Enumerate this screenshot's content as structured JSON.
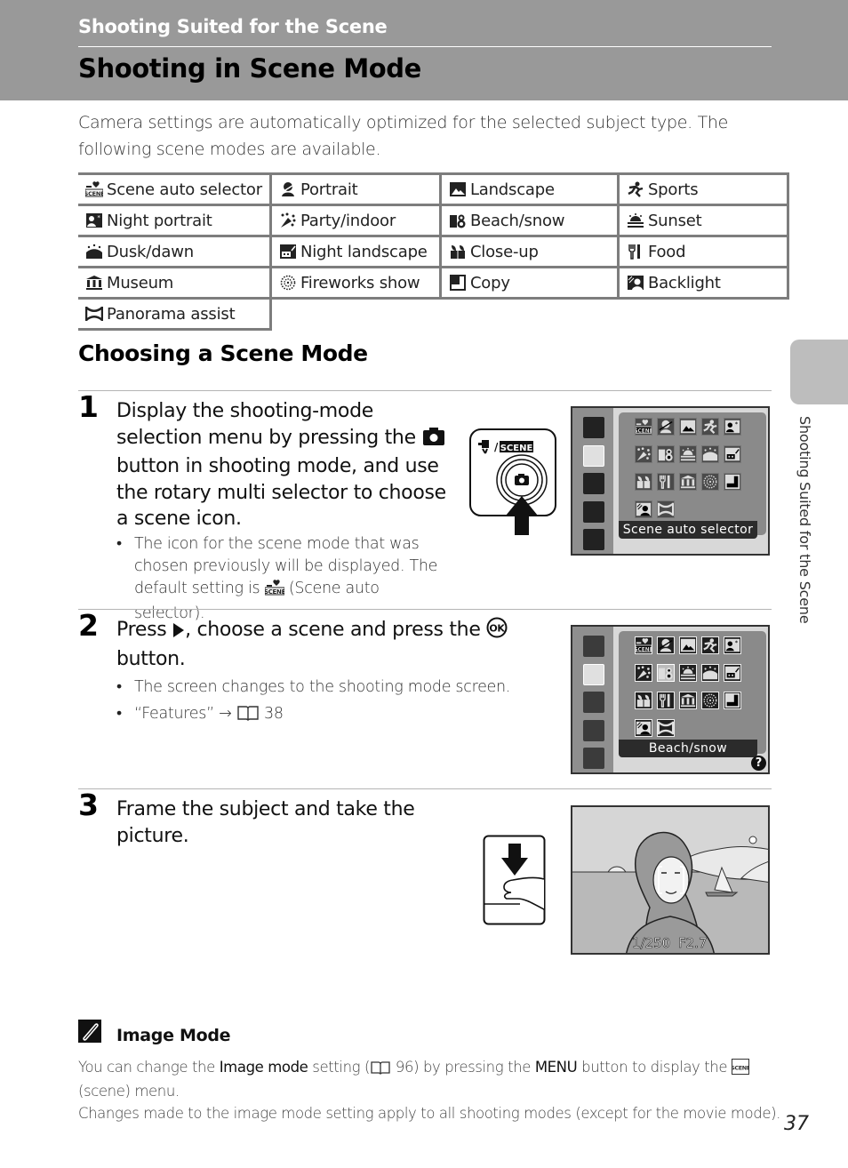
{
  "header": {
    "section_title": "Shooting Suited for the Scene",
    "page_title": "Shooting in Scene Mode"
  },
  "intro": "Camera settings are automatically optimized for the selected subject type. The following scene modes are available.",
  "scene_modes": [
    [
      {
        "icon": "scene-auto-selector-icon",
        "label": "Scene auto selector"
      },
      {
        "icon": "portrait-icon",
        "label": "Portrait"
      },
      {
        "icon": "landscape-icon",
        "label": "Landscape"
      },
      {
        "icon": "sports-icon",
        "label": "Sports"
      }
    ],
    [
      {
        "icon": "night-portrait-icon",
        "label": "Night portrait"
      },
      {
        "icon": "party-indoor-icon",
        "label": "Party/indoor"
      },
      {
        "icon": "beach-snow-icon",
        "label": "Beach/snow"
      },
      {
        "icon": "sunset-icon",
        "label": "Sunset"
      }
    ],
    [
      {
        "icon": "dusk-dawn-icon",
        "label": "Dusk/dawn"
      },
      {
        "icon": "night-landscape-icon",
        "label": "Night landscape"
      },
      {
        "icon": "close-up-icon",
        "label": "Close-up"
      },
      {
        "icon": "food-icon",
        "label": "Food"
      }
    ],
    [
      {
        "icon": "museum-icon",
        "label": "Museum"
      },
      {
        "icon": "fireworks-show-icon",
        "label": "Fireworks show"
      },
      {
        "icon": "copy-icon",
        "label": "Copy"
      },
      {
        "icon": "backlight-icon",
        "label": "Backlight"
      }
    ],
    [
      {
        "icon": "panorama-assist-icon",
        "label": "Panorama assist"
      }
    ]
  ],
  "choosing": {
    "heading": "Choosing a Scene Mode",
    "steps": [
      {
        "number": "1",
        "text_parts": [
          "Display the shooting-mode selection menu by pressing the",
          "button in shooting mode, and use the rotary multi selector to choose a scene icon."
        ],
        "bullets": [
          {
            "parts": [
              "The icon for the scene mode that was chosen previously will be displayed. The default setting is",
              "(Scene auto selector)."
            ]
          }
        ],
        "button_label": "SCENE",
        "screen_label": "Scene auto selector"
      },
      {
        "number": "2",
        "text_parts": [
          "Press",
          ", choose a scene and press the",
          "button."
        ],
        "bullets": [
          {
            "parts": [
              "The screen changes to the shooting mode screen."
            ]
          },
          {
            "parts": [
              "“Features” →",
              "38"
            ]
          }
        ],
        "screen_label": "Beach/snow",
        "help_glyph": "?"
      },
      {
        "number": "3",
        "text": "Frame the subject and take the picture.",
        "shutter_speed": "1/250",
        "aperture": "F2.7"
      }
    ]
  },
  "note": {
    "title": "Image Mode",
    "p1_parts": [
      "You can change the",
      "Image mode",
      "setting (",
      "96) by pressing the",
      "MENU",
      "button to display the",
      "(scene) menu."
    ],
    "p2": "Changes made to the image mode setting apply to all shooting modes (except for the movie mode)."
  },
  "side_tab_text": "Shooting Suited for the Scene",
  "page_number": "37"
}
